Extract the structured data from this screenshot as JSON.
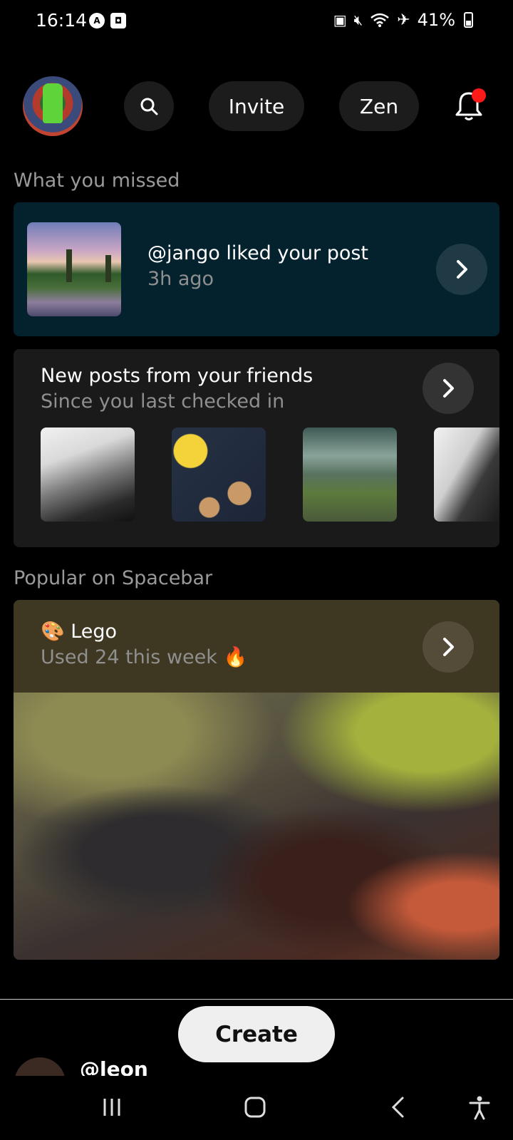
{
  "status_bar": {
    "time": "16:14",
    "battery": "41%"
  },
  "top_nav": {
    "invite_label": "Invite",
    "zen_label": "Zen"
  },
  "missed": {
    "section_title": "What you missed",
    "title": "@jango liked your post",
    "time": "3h ago"
  },
  "friends": {
    "title": "New posts from your friends",
    "subtitle": "Since you last checked in"
  },
  "popular": {
    "section_title": "Popular on Spacebar",
    "emoji": "🎨",
    "title": "Lego",
    "subtitle": "Used 24 this week",
    "fire": "🔥"
  },
  "bottom": {
    "create_label": "Create",
    "peek_username": "@leon"
  },
  "colors": {
    "missed_card": "#03222e",
    "friends_card": "#1a1a1a",
    "popular_card": "#3e3722",
    "notification_dot": "#ff1a1a"
  }
}
